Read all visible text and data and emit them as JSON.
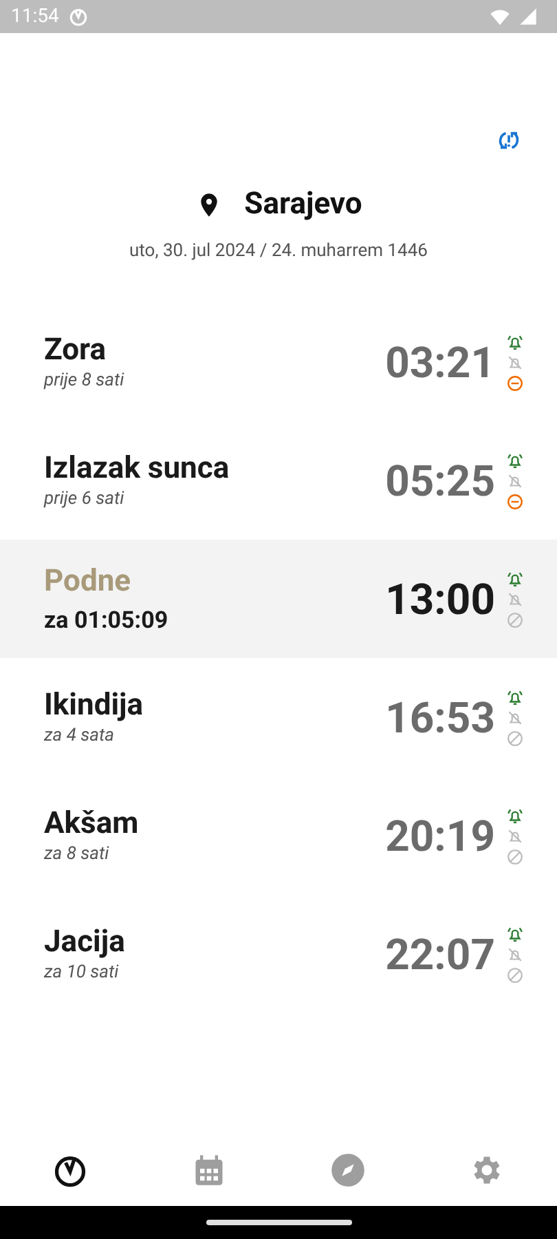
{
  "status_bar": {
    "time": "11:54"
  },
  "location": {
    "city": "Sarajevo",
    "date": "uto, 30. jul 2024 / 24. muharrem 1446"
  },
  "prayers": [
    {
      "name": "Zora",
      "relative": "prije 8 sati",
      "time": "03:21",
      "selected": false,
      "alarm": true,
      "pre_alarm": false,
      "silent": true
    },
    {
      "name": "Izlazak sunca",
      "relative": "prije 6 sati",
      "time": "05:25",
      "selected": false,
      "alarm": true,
      "pre_alarm": false,
      "silent": true
    },
    {
      "name": "Podne",
      "relative": "za 01:05:09",
      "time": "13:00",
      "selected": true,
      "alarm": true,
      "pre_alarm": false,
      "silent": false
    },
    {
      "name": "Ikindija",
      "relative": "za 4 sata",
      "time": "16:53",
      "selected": false,
      "alarm": true,
      "pre_alarm": false,
      "silent": false
    },
    {
      "name": "Akšam",
      "relative": "za 8 sati",
      "time": "20:19",
      "selected": false,
      "alarm": true,
      "pre_alarm": false,
      "silent": false
    },
    {
      "name": "Jacija",
      "relative": "za 10 sati",
      "time": "22:07",
      "selected": false,
      "alarm": true,
      "pre_alarm": false,
      "silent": false
    }
  ],
  "bottom_nav": [
    {
      "kind": "times",
      "selected": true
    },
    {
      "kind": "calendar",
      "selected": false
    },
    {
      "kind": "compass",
      "selected": false
    },
    {
      "kind": "settings",
      "selected": false
    }
  ]
}
